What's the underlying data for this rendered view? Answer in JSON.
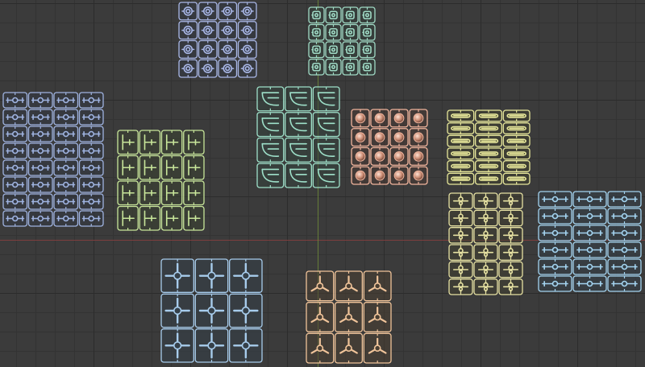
{
  "viewport": {
    "background": "#3b3b3b",
    "grid_color": "#2c2c2c",
    "x_axis_color": "#8a3f3f",
    "y_axis_color": "#6f8a3a"
  },
  "groups": [
    {
      "id": "ring-parts",
      "shape": "ring",
      "color": "#a9b7e6",
      "fill": "#333844",
      "cols": 4,
      "rows": 4
    },
    {
      "id": "gear-parts",
      "shape": "gear",
      "color": "#9fd9c4",
      "fill": "#33403b",
      "cols": 4,
      "rows": 4
    },
    {
      "id": "dumbbell-parts",
      "shape": "dumbbell",
      "color": "#9fb3e0",
      "fill": "#333844",
      "cols": 4,
      "rows": 8
    },
    {
      "id": "tee-parts",
      "shape": "tee",
      "color": "#c8e69a",
      "fill": "#3a4232",
      "cols": 4,
      "rows": 4
    },
    {
      "id": "hook-parts",
      "shape": "hook",
      "color": "#9ee0c9",
      "fill": "#34443e",
      "cols": 3,
      "rows": 4
    },
    {
      "id": "sphere-parts",
      "shape": "sphere",
      "color": "#f0b49c",
      "fill": "#4a3a35",
      "cols": 4,
      "rows": 4
    },
    {
      "id": "bar-parts",
      "shape": "bar",
      "color": "#e6e69a",
      "fill": "#42422f",
      "cols": 3,
      "rows": 6
    },
    {
      "id": "link-parts",
      "shape": "link",
      "color": "#e6e1a2",
      "fill": "#424032",
      "cols": 3,
      "rows": 6
    },
    {
      "id": "connector-parts",
      "shape": "dumbbell",
      "color": "#a4d4f0",
      "fill": "#344049",
      "cols": 3,
      "rows": 6
    },
    {
      "id": "cross-parts",
      "shape": "cross",
      "color": "#a7ccec",
      "fill": "#354049",
      "cols": 3,
      "rows": 3
    },
    {
      "id": "tripod-parts",
      "shape": "tripod",
      "color": "#f0c49a",
      "fill": "#4a3f33",
      "cols": 3,
      "rows": 3
    }
  ]
}
